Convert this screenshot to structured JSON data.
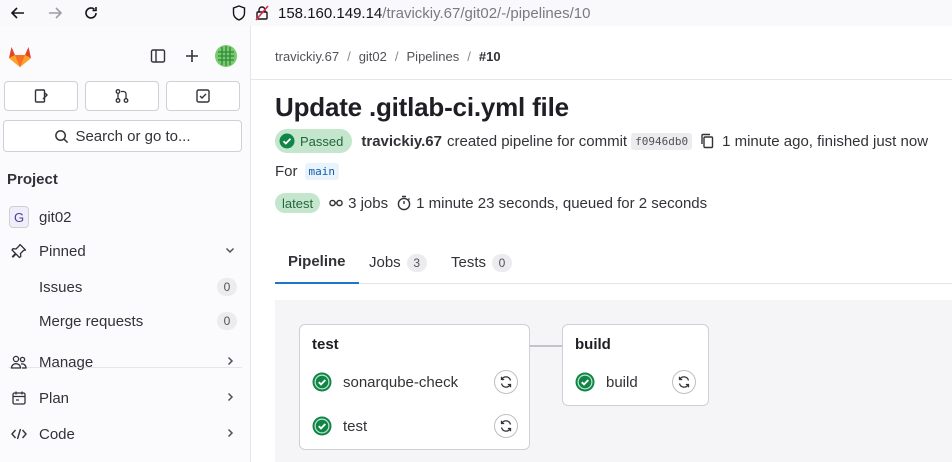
{
  "browser": {
    "url_host": "158.160.149.14",
    "url_path": "/travickiy.67/git02/-/pipelines/10"
  },
  "sidebar": {
    "search_label": "Search or go to...",
    "section_title": "Project",
    "project_initial": "G",
    "project_name": "git02",
    "pinned_label": "Pinned",
    "issues_label": "Issues",
    "issues_count": "0",
    "mr_label": "Merge requests",
    "mr_count": "0",
    "manage_label": "Manage",
    "plan_label": "Plan",
    "code_label": "Code"
  },
  "breadcrumb": {
    "items": [
      "travickiy.67",
      "git02",
      "Pipelines",
      "#10"
    ],
    "separator": "/"
  },
  "pipeline": {
    "title": "Update .gitlab-ci.yml file",
    "status": "Passed",
    "author": "travickiy.67",
    "created_text": "created pipeline for commit",
    "commit_sha": "f0946db0",
    "time_text": "1 minute ago, finished just now",
    "for_label": "For",
    "branch": "main",
    "latest_badge": "latest",
    "jobs_text": "3 jobs",
    "duration_text": "1 minute 23 seconds, queued for 2 seconds"
  },
  "tabs": [
    {
      "label": "Pipeline",
      "count": ""
    },
    {
      "label": "Jobs",
      "count": "3"
    },
    {
      "label": "Tests",
      "count": "0"
    }
  ],
  "stages": [
    {
      "name": "test",
      "jobs": [
        "sonarqube-check",
        "test"
      ]
    },
    {
      "name": "build",
      "jobs": [
        "build"
      ]
    }
  ],
  "colors": {
    "success": "#108548",
    "accent": "#1f75cb",
    "passed_bg": "#c3e6cd"
  }
}
